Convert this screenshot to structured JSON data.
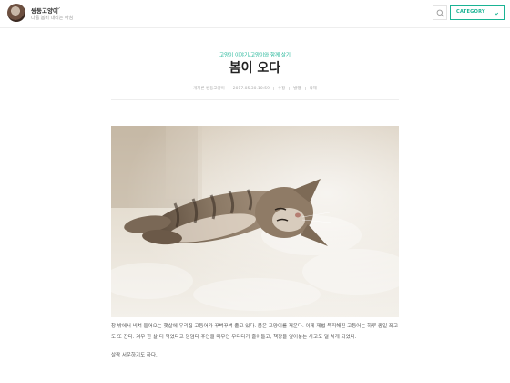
{
  "header": {
    "blog_name": "쌍둥고양이",
    "blog_description": "다룸 봄비 내리는 아침",
    "search_icon": "search-icon",
    "category_label": "CATEGORY",
    "category_icon": "chevron-down-icon",
    "accent_color": "#1ab394"
  },
  "post": {
    "category": "고양이 이야기/고양이와 함께 살기",
    "title": "봄이 오다",
    "meta": [
      "게자른 쌍둥고양이",
      "2017.05.30.10:59",
      "수정",
      "발행",
      "삭제"
    ],
    "image_alt": "고양이",
    "paragraphs": [
      "창 밖에서 비쳐 들어오는 햇살에 우리집 고등어가 꾸벅꾸벅 졸고 있다. 봄은 고양이를 재운다. 이제 제법 묵직해진 고등어는 하루 종일 좌고도 또 잔다. 겨우 한 살 더 먹었다고 덤덤다 주인을 마우인 우다다가 줄어들고, 책장을 엎어놓는 사고도 덜 치게 되었다.",
      "살짝 서운하기도 하다."
    ]
  }
}
